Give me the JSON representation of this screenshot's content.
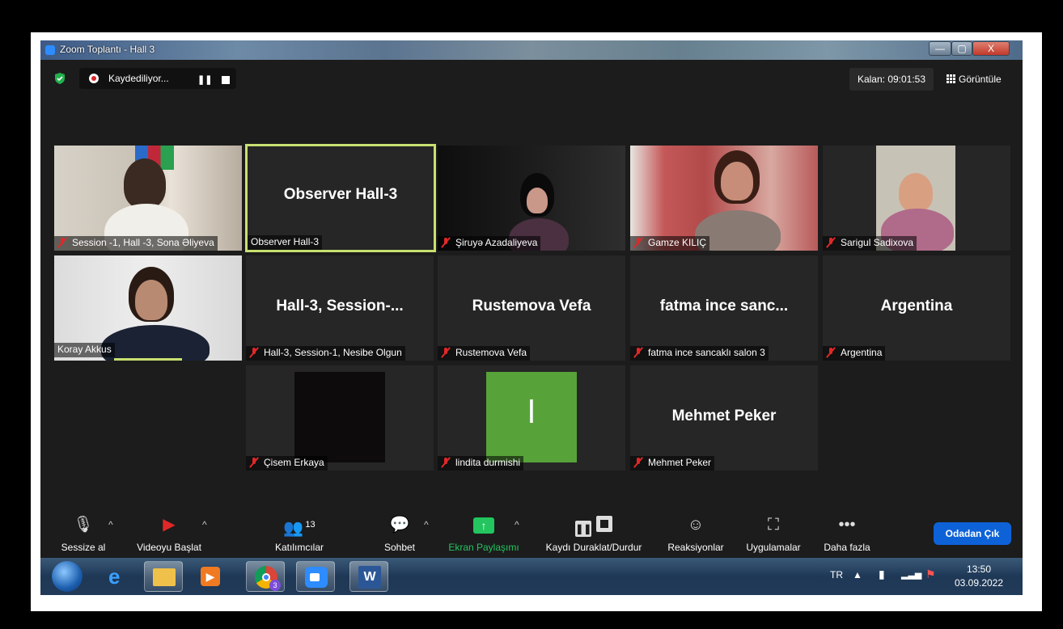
{
  "window": {
    "title": "Zoom Toplantı - Hall 3",
    "controls": {
      "minimize": "—",
      "maximize": "▢",
      "close": "X"
    }
  },
  "topbar": {
    "recording": "Kaydediliyor...",
    "remaining": "Kalan: 09:01:53",
    "view": "Görüntüle"
  },
  "tiles": [
    {
      "label": "Session -1, Hall -3, Sona Əliyeva",
      "big": "",
      "video": true
    },
    {
      "label": "Observer Hall-3",
      "big": "Observer Hall-3",
      "video": false,
      "active": true
    },
    {
      "label": "Şiruyə Azadaliyeva",
      "big": "",
      "video": true
    },
    {
      "label": "Gamze KILIÇ",
      "big": "",
      "video": true
    },
    {
      "label": "Sarigul Sadixova",
      "big": "",
      "video": true
    },
    {
      "label": "Koray Akkus",
      "big": "",
      "video": true
    },
    {
      "label": "Hall-3, Session-1, Nesibe Olgun",
      "big": "Hall-3,  Session-...",
      "video": false
    },
    {
      "label": "Rustemova Vefa",
      "big": "Rustemova Vefa",
      "video": false
    },
    {
      "label": "fatma ince sancaklı salon 3",
      "big": "fatma ince sanc...",
      "video": false
    },
    {
      "label": "Argentina",
      "big": "Argentina",
      "video": false
    },
    {
      "label": "Çisem Erkaya",
      "big": "",
      "video": true
    },
    {
      "label": "lindita durmishi",
      "big": "l",
      "video": false
    },
    {
      "label": "Mehmet Peker",
      "big": "Mehmet Peker",
      "video": false
    }
  ],
  "toolbar": {
    "mute": "Sessize al",
    "video": "Videoyu Başlat",
    "participants": "Katılımcılar",
    "participants_count": "13",
    "chat": "Sohbet",
    "share": "Ekran Paylaşımı",
    "record": "Kaydı Duraklat/Durdur",
    "reactions": "Reaksiyonlar",
    "apps": "Uygulamalar",
    "more": "Daha fazla",
    "more_icon": "•••",
    "leave": "Odadan Çık"
  },
  "taskbar": {
    "lang": "TR",
    "time": "13:50",
    "date": "03.09.2022",
    "word_letter": "W",
    "chrome_badge": "3"
  },
  "colors": {
    "share_green": "#22c55e",
    "leave_blue": "#0e62d8",
    "active_border": "#c8e070",
    "muted_red": "#e02828",
    "avatar_green": "#57a33a"
  }
}
